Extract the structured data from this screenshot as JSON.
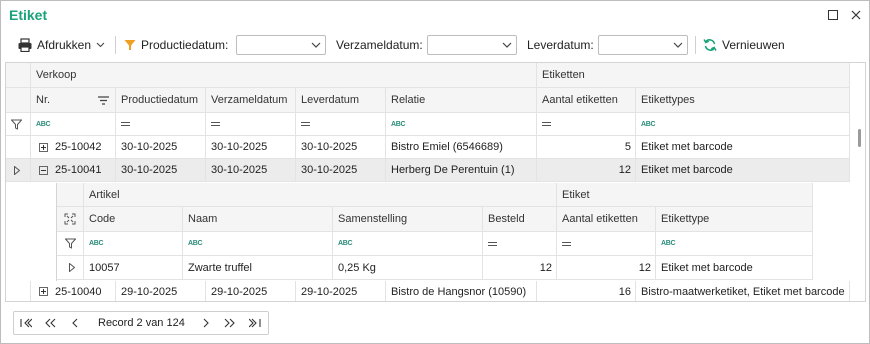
{
  "window": {
    "title": "Etiket"
  },
  "toolbar": {
    "print_label": "Afdrukken",
    "productiedatum_label": "Productiedatum:",
    "verzameldatum_label": "Verzameldatum:",
    "leverdatum_label": "Leverdatum:",
    "refresh_label": "Vernieuwen",
    "productiedatum_value": "",
    "verzameldatum_value": "",
    "leverdatum_value": ""
  },
  "grid": {
    "band_verkoop": "Verkoop",
    "band_etiketten": "Etiketten",
    "columns": {
      "nr": "Nr.",
      "productiedatum": "Productiedatum",
      "verzameldatum": "Verzameldatum",
      "leverdatum": "Leverdatum",
      "relatie": "Relatie",
      "aantal_etiketten": "Aantal etiketten",
      "etikettypes": "Etikettypes"
    },
    "filter_abc": "ABC",
    "rows": [
      {
        "nr": "25-10042",
        "productiedatum": "30-10-2025",
        "verzameldatum": "30-10-2025",
        "leverdatum": "30-10-2025",
        "relatie": "Bistro Emiel (6546689)",
        "aantal_etiketten": "5",
        "etikettypes": "Etiket met barcode"
      },
      {
        "nr": "25-10041",
        "productiedatum": "30-10-2025",
        "verzameldatum": "30-10-2025",
        "leverdatum": "30-10-2025",
        "relatie": "Herberg De Perentuin (1)",
        "aantal_etiketten": "12",
        "etikettypes": "Etiket met barcode"
      },
      {
        "nr": "25-10040",
        "productiedatum": "29-10-2025",
        "verzameldatum": "29-10-2025",
        "leverdatum": "29-10-2025",
        "relatie": "Bistro de Hangsnor (10590)",
        "aantal_etiketten": "16",
        "etikettypes": "Bistro-maatwerketiket, Etiket met barcode"
      }
    ],
    "detail": {
      "band_artikel": "Artikel",
      "band_etiket": "Etiket",
      "columns": {
        "code": "Code",
        "naam": "Naam",
        "samenstelling": "Samenstelling",
        "besteld": "Besteld",
        "aantal_etiketten": "Aantal etiketten",
        "etikettype": "Etikettype"
      },
      "rows": [
        {
          "code": "10057",
          "naam": "Zwarte truffel",
          "samenstelling": "0,25 Kg",
          "besteld": "12",
          "aantal_etiketten": "12",
          "etikettype": "Etiket met barcode"
        }
      ]
    }
  },
  "pager": {
    "record_text": "Record 2 van 124"
  },
  "colors": {
    "accent": "#1aa37a",
    "filter_icon": "#f0a020",
    "refresh_icon": "#1aa37a"
  },
  "icons": [
    "maximize-icon",
    "close-icon",
    "printer-icon",
    "chevron-down-icon",
    "funnel-icon",
    "refresh-icon",
    "sort-icon",
    "filter-icon",
    "expand-all-icon",
    "row-indicator-icon"
  ]
}
